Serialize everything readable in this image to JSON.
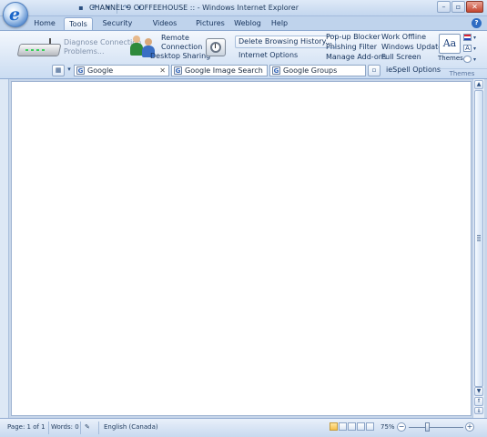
{
  "window": {
    "title": "CHANNEL 9 COFFEEHOUSE :: - Windows Internet Explorer"
  },
  "tabs": [
    {
      "label": "Home"
    },
    {
      "label": "Tools"
    },
    {
      "label": "Security"
    },
    {
      "label": "Videos"
    },
    {
      "label": "Pictures"
    },
    {
      "label": "Weblog"
    },
    {
      "label": "Help"
    }
  ],
  "active_tab": "Tools",
  "ribbon": {
    "diagnose_line1": "Diagnose Connection",
    "diagnose_line2": "Problems...",
    "remote_line1": "Remote",
    "remote_line2": "Connection",
    "desktop_sharing": "Desktop Sharing",
    "delete_history": "Delete Browsing History...",
    "internet_options": "Internet Options",
    "popup_blocker": "Pop-up Blocker",
    "phishing_filter": "Phishing Filter",
    "manage_addons": "Manage Add-ons",
    "work_offline": "Work Offline",
    "windows_update": "Windows Update",
    "full_screen": "Full Screen",
    "themes_label": "Themes",
    "themes_group": "Themes"
  },
  "toolbar": {
    "search_tabs": [
      "Google",
      "Google Image Search",
      "Google Groups"
    ],
    "iespell": "ieSpell Options"
  },
  "status": {
    "page": "Page: 1 of 1",
    "words": "Words: 0",
    "language": "English (Canada)",
    "zoom": "75%"
  },
  "colors": {
    "ribbon": "#dbe7f6",
    "accent": "#2e6cc3"
  }
}
